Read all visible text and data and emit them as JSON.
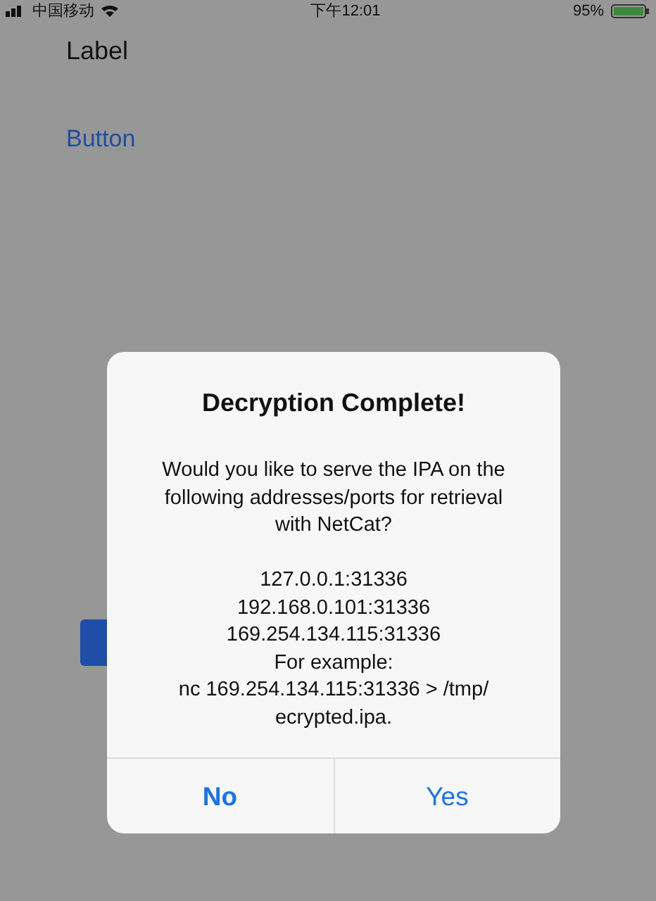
{
  "status_bar": {
    "carrier": "中国移动",
    "time": "下午12:01",
    "battery": "95%"
  },
  "label": "Label",
  "button": "Button",
  "alert": {
    "title": "Decryption Complete!",
    "message": "Would you like to serve the IPA on the\nfollowing addresses/ports for retrieval\nwith NetCat?\n\n127.0.0.1:31336\n192.168.0.101:31336\n169.254.134.115:31336\nFor example:\nnc 169.254.134.115:31336 > /tmp/\necrypted.ipa.",
    "actions": [
      {
        "label": "No",
        "preferred": true
      },
      {
        "label": "Yes",
        "preferred": false
      }
    ]
  }
}
